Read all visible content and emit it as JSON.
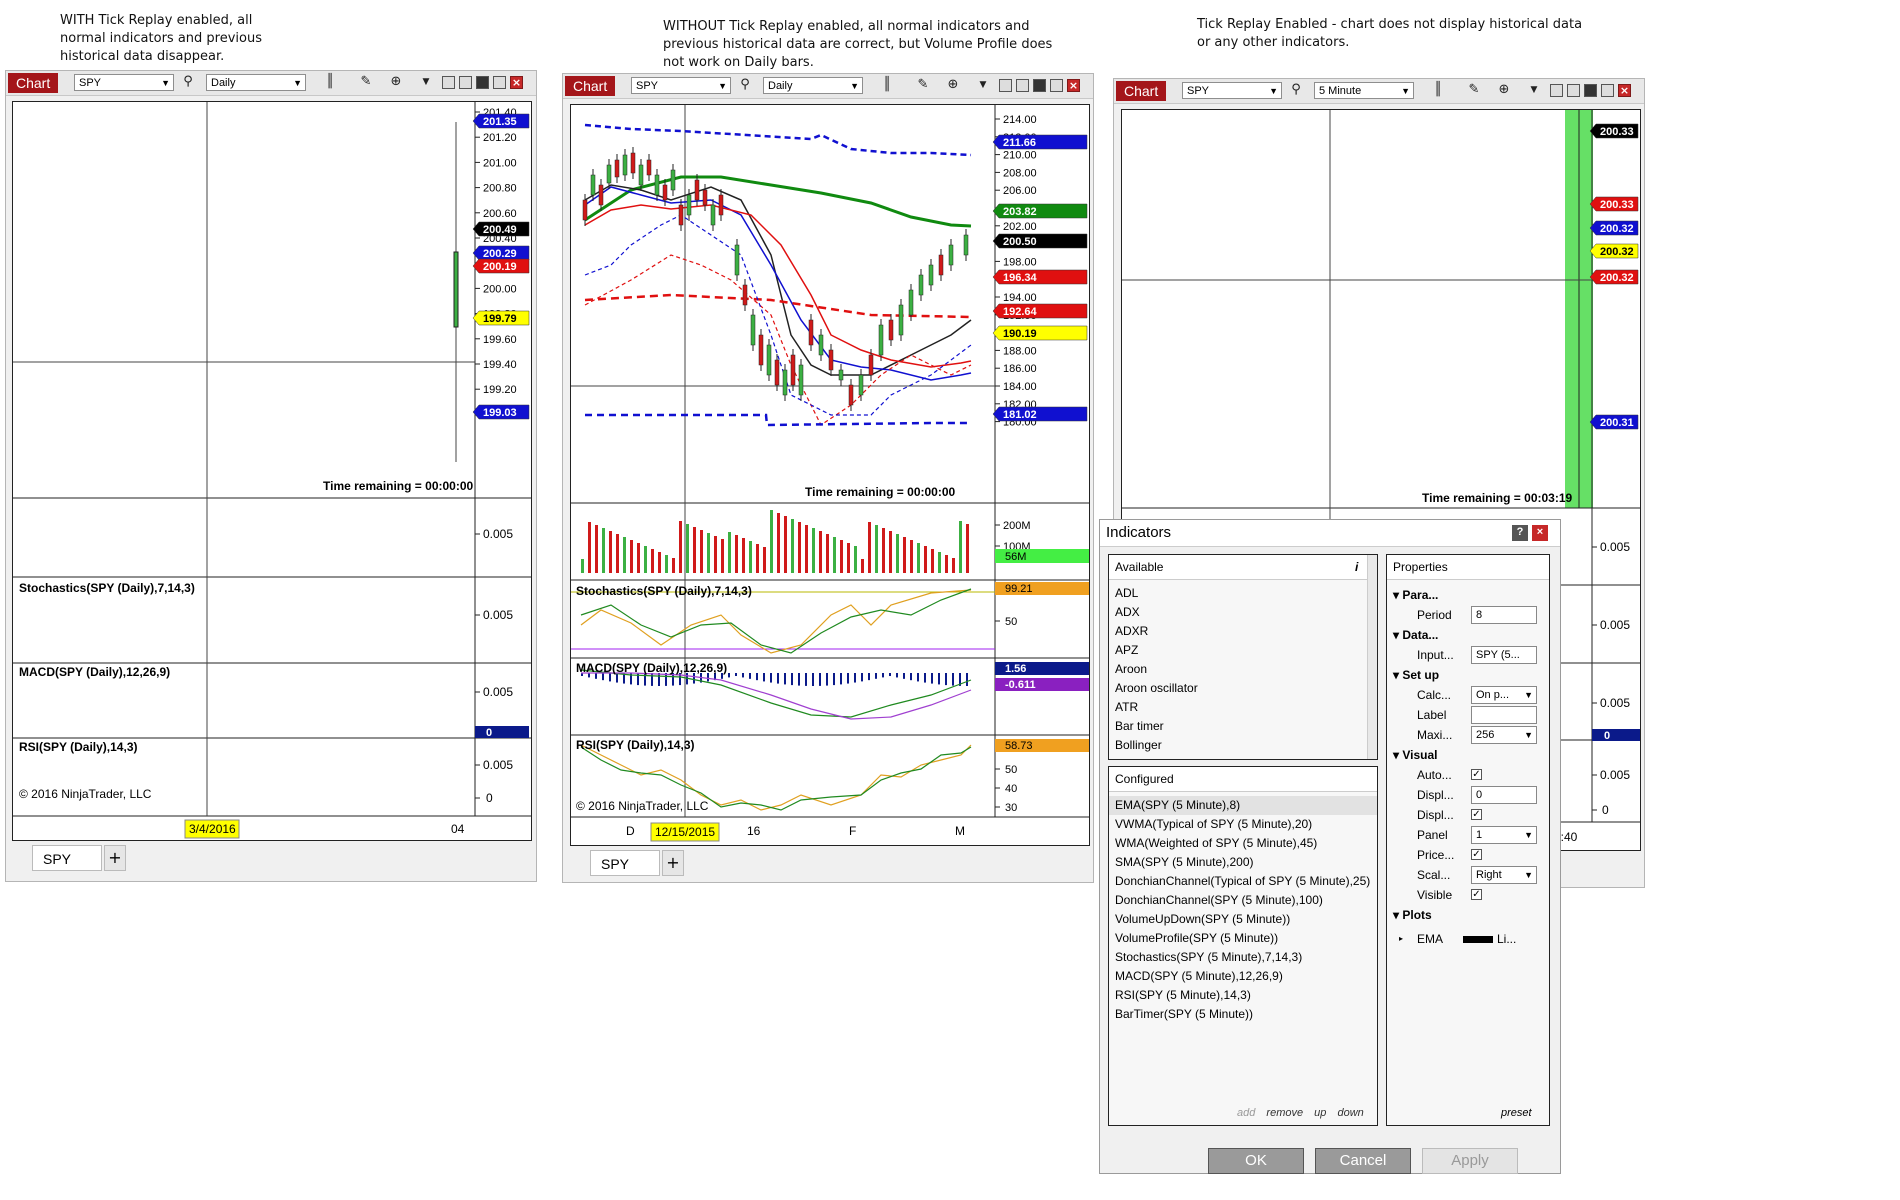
{
  "notes": {
    "left": "WITH Tick Replay enabled, all normal indicators and previous historical data disappear.",
    "middle": "WITHOUT Tick Replay enabled, all normal indicators and previous historical data are correct, but Volume Profile does not work on Daily bars.",
    "right": "Tick Replay Enabled - chart does not display historical data or any other indicators."
  },
  "left_chart": {
    "chart_label": "Chart",
    "instrument": "SPY",
    "interval": "Daily",
    "price_ticks": [
      "201.40",
      "201.20",
      "201.00",
      "200.80",
      "200.60",
      "200.40",
      "200.20",
      "200.00",
      "199.80",
      "199.60",
      "199.40",
      "199.20",
      "199.00"
    ],
    "flags": [
      {
        "text": "201.35",
        "color": "#1010d0",
        "fg": "#ffffff"
      },
      {
        "text": "200.49",
        "color": "#000000",
        "fg": "#ffffff"
      },
      {
        "text": "200.29",
        "color": "#1010d0",
        "fg": "#ffffff"
      },
      {
        "text": "200.19",
        "color": "#e01010",
        "fg": "#ffffff"
      },
      {
        "text": "199.79",
        "color": "#ffff00",
        "fg": "#000000"
      },
      {
        "text": "199.03",
        "color": "#1010d0",
        "fg": "#ffffff"
      }
    ],
    "time_remaining": "Time remaining = 00:00:00",
    "volume_tick": "0.005",
    "stoch_label": "Stochastics(SPY (Daily),7,14,3)",
    "stoch_tick": "0.005",
    "macd_label": "MACD(SPY (Daily),12,26,9)",
    "macd_tick": "0.005",
    "macd_flag": "0",
    "rsi_label": "RSI(SPY (Daily),14,3)",
    "rsi_tick": "0.005",
    "rsi_zero": "0",
    "copyright": "© 2016 NinjaTrader, LLC",
    "date_label": "3/4/2016",
    "x_tick": "04",
    "tab": "SPY",
    "tab_add": "+"
  },
  "middle_chart": {
    "chart_label": "Chart",
    "instrument": "SPY",
    "interval": "Daily",
    "price_ticks": [
      "214.00",
      "212.00",
      "210.00",
      "208.00",
      "206.00",
      "204.00",
      "202.00",
      "200.00",
      "198.00",
      "196.00",
      "194.00",
      "192.00",
      "190.00",
      "188.00",
      "186.00",
      "184.00",
      "182.00",
      "180.00"
    ],
    "flags": [
      {
        "text": "211.66",
        "color": "#1010d0",
        "fg": "#ffffff"
      },
      {
        "text": "203.82",
        "color": "#108a10",
        "fg": "#ffffff"
      },
      {
        "text": "200.50",
        "color": "#000000",
        "fg": "#ffffff"
      },
      {
        "text": "196.34",
        "color": "#e01010",
        "fg": "#ffffff"
      },
      {
        "text": "192.64",
        "color": "#e01010",
        "fg": "#ffffff"
      },
      {
        "text": "190.19",
        "color": "#ffff00",
        "fg": "#000000"
      },
      {
        "text": "181.02",
        "color": "#1010d0",
        "fg": "#ffffff"
      }
    ],
    "time_remaining": "Time remaining = 00:00:00",
    "volume_ticks": [
      "200M",
      "100M"
    ],
    "volume_flag": "56M",
    "stoch_label": "Stochastics(SPY (Daily),7,14,3)",
    "stoch_flag": "99.21",
    "stoch_tick": "50",
    "macd_label": "MACD(SPY (Daily),12,26,9)",
    "macd_flags": [
      "1.56",
      "-0.611"
    ],
    "rsi_label": "RSI(SPY (Daily),14,3)",
    "rsi_flag": "58.73",
    "rsi_ticks": [
      "50",
      "40",
      "30"
    ],
    "copyright": "© 2016 NinjaTrader, LLC",
    "x_ticks": [
      "D",
      "16",
      "F",
      "M"
    ],
    "date_label": "12/15/2015",
    "tab": "SPY",
    "tab_add": "+"
  },
  "right_chart": {
    "chart_label": "Chart",
    "instrument": "SPY",
    "interval": "5 Minute",
    "flags": [
      {
        "text": "200.33",
        "color": "#000000",
        "fg": "#ffffff"
      },
      {
        "text": "200.33",
        "color": "#e01010",
        "fg": "#ffffff"
      },
      {
        "text": "200.32",
        "color": "#1010d0",
        "fg": "#ffffff"
      },
      {
        "text": "200.32",
        "color": "#ffff00",
        "fg": "#000000"
      },
      {
        "text": "200.32",
        "color": "#e01010",
        "fg": "#ffffff"
      },
      {
        "text": "200.31",
        "color": "#1010d0",
        "fg": "#ffffff"
      }
    ],
    "time_remaining": "Time remaining = 00:03:19",
    "panel_ticks": [
      "0.005",
      "0.005",
      "0.005",
      "0.005"
    ],
    "macd_flag": "0",
    "rsi_zero": "0",
    "x_tick": "5:40"
  },
  "indicators_dialog": {
    "title": "Indicators",
    "help": "?",
    "close": "×",
    "available_header": "Available",
    "info": "i",
    "available": [
      "ADL",
      "ADX",
      "ADXR",
      "APZ",
      "Aroon",
      "Aroon oscillator",
      "ATR",
      "Bar timer",
      "Bollinger"
    ],
    "configured_header": "Configured",
    "configured": [
      "EMA(SPY (5 Minute),8)",
      "VWMA(Typical of SPY (5 Minute),20)",
      "WMA(Weighted of SPY (5 Minute),45)",
      "SMA(SPY (5 Minute),200)",
      "DonchianChannel(Typical of SPY (5 Minute),25)",
      "DonchianChannel(SPY (5 Minute),100)",
      "VolumeUpDown(SPY (5 Minute))",
      "VolumeProfile(SPY (5 Minute))",
      "Stochastics(SPY (5 Minute),7,14,3)",
      "MACD(SPY (5 Minute),12,26,9)",
      "RSI(SPY (5 Minute),14,3)",
      "BarTimer(SPY (5 Minute))"
    ],
    "links": {
      "add": "add",
      "remove": "remove",
      "up": "up",
      "down": "down"
    },
    "properties_header": "Properties",
    "sections": {
      "params": "Para...",
      "data": "Data...",
      "setup": "Set up",
      "visual": "Visual",
      "plots": "Plots"
    },
    "props": {
      "period_label": "Period",
      "period_value": "8",
      "input_label": "Input...",
      "input_value": "SPY (5...",
      "calc_label": "Calc...",
      "calc_value": "On p...",
      "label_label": "Label",
      "label_value": "",
      "maxi_label": "Maxi...",
      "maxi_value": "256",
      "auto_label": "Auto...",
      "displ1_label": "Displ...",
      "displ1_value": "0",
      "displ2_label": "Displ...",
      "panel_label": "Panel",
      "panel_value": "1",
      "price_label": "Price...",
      "scal_label": "Scal...",
      "scal_value": "Right",
      "visible_label": "Visible",
      "ema_label": "EMA",
      "ema_value": "Li..."
    },
    "preset": "preset",
    "ok": "OK",
    "cancel": "Cancel",
    "apply": "Apply"
  }
}
